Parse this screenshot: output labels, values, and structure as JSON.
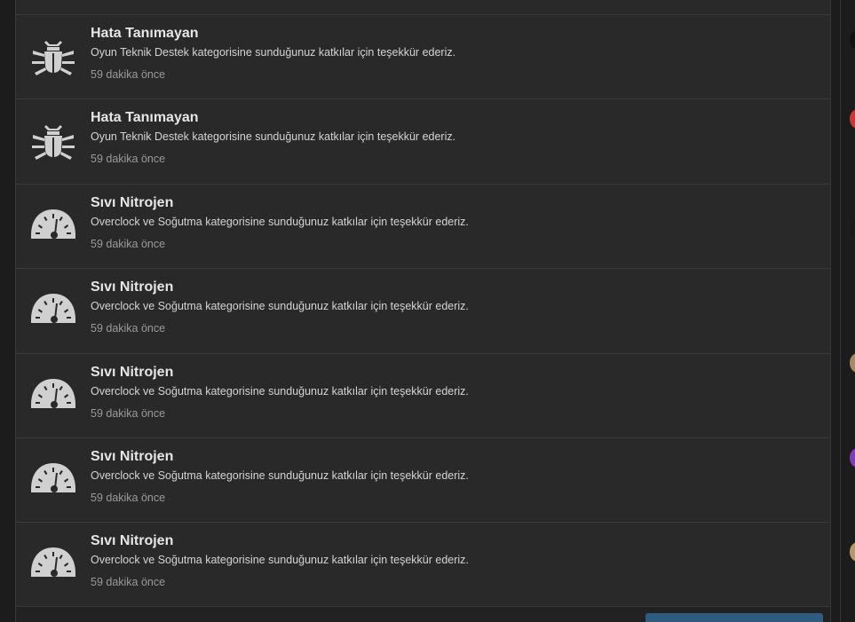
{
  "notifications": [
    {
      "icon": "bug-icon",
      "title": "Hata Tanımayan",
      "description": "Oyun Teknik Destek kategorisine sunduğunuz katkılar için teşekkür ederiz.",
      "time": "59 dakika önce"
    },
    {
      "icon": "bug-icon",
      "title": "Hata Tanımayan",
      "description": "Oyun Teknik Destek kategorisine sunduğunuz katkılar için teşekkür ederiz.",
      "time": "59 dakika önce"
    },
    {
      "icon": "speedometer-icon",
      "title": "Sıvı Nitrojen",
      "description": "Overclock ve Soğutma kategorisine sunduğunuz katkılar için teşekkür ederiz.",
      "time": "59 dakika önce"
    },
    {
      "icon": "speedometer-icon",
      "title": "Sıvı Nitrojen",
      "description": "Overclock ve Soğutma kategorisine sunduğunuz katkılar için teşekkür ederiz.",
      "time": "59 dakika önce"
    },
    {
      "icon": "speedometer-icon",
      "title": "Sıvı Nitrojen",
      "description": "Overclock ve Soğutma kategorisine sunduğunuz katkılar için teşekkür ederiz.",
      "time": "59 dakika önce"
    },
    {
      "icon": "speedometer-icon",
      "title": "Sıvı Nitrojen",
      "description": "Overclock ve Soğutma kategorisine sunduğunuz katkılar için teşekkür ederiz.",
      "time": "59 dakika önce"
    },
    {
      "icon": "speedometer-icon",
      "title": "Sıvı Nitrojen",
      "description": "Overclock ve Soğutma kategorisine sunduğunuz katkılar için teşekkür ederiz.",
      "time": "59 dakika önce"
    }
  ],
  "colors": {
    "background": "#1c1c1c",
    "panel": "#292929",
    "icon": "#d0d0d0",
    "title": "#e6e6e6",
    "description": "#d4d4d4",
    "time": "#9a9a9a",
    "button": "#2e5b7f"
  },
  "sidebar_avatars": [
    {
      "color": "#111111"
    },
    {
      "color": "#c83838"
    },
    {
      "color": "#1a1a1a"
    },
    {
      "color": "#a58b6b"
    },
    {
      "color": "#7d3fb0"
    },
    {
      "color": "#b59770"
    }
  ]
}
